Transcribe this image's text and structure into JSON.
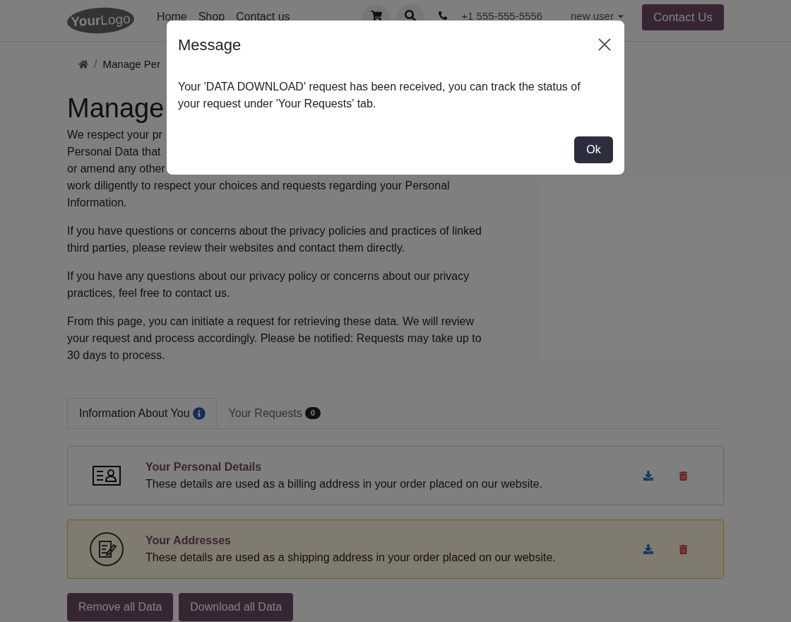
{
  "header": {
    "logo": {
      "bold": "Your",
      "rest": "Logo"
    },
    "nav": [
      {
        "label": "Home"
      },
      {
        "label": "Shop"
      },
      {
        "label": "Contact us"
      }
    ],
    "phone": "+1 555-555-5556",
    "user": "new user",
    "cta": "Contact Us"
  },
  "breadcrumb": {
    "separator": "/",
    "current": "Manage Per"
  },
  "title": "Manage",
  "intro_lines": [
    "We respect your pr",
    "Personal Data that",
    "or amend any other",
    "work diligently to respect your choices and requests regarding your Personal",
    "Information."
  ],
  "paragraphs": [
    "If you have questions or concerns about the privacy policies and practices of linked third parties, please review their websites and contact them directly.",
    "If you have any questions about our privacy policy or concerns about our privacy practices, feel free to contact us.",
    "From this page, you can initiate a request for retrieving these data. We will review your request and process accordingly. Please be notified: Requests may take up to 30 days to process."
  ],
  "tabs": [
    {
      "label": "Information About You",
      "selected": true,
      "kind": "info"
    },
    {
      "label": "Your Requests",
      "selected": false,
      "kind": "count",
      "badge": "0"
    }
  ],
  "cards": [
    {
      "kind": "id-card",
      "highlighted": false,
      "title": "Your Personal Details",
      "text": "These details are used as a billing address in your order placed on our website."
    },
    {
      "kind": "form",
      "highlighted": true,
      "title": "Your Addresses",
      "text": "These details are used as a shipping address in your order placed on our website."
    }
  ],
  "buttons": [
    "Remove all Data",
    "Download all Data"
  ],
  "modal": {
    "title": "Message",
    "text": "Your 'DATA DOWNLOAD' request has been received, you can track the status of your request under 'Your Requests' tab.",
    "button": "Ok"
  }
}
